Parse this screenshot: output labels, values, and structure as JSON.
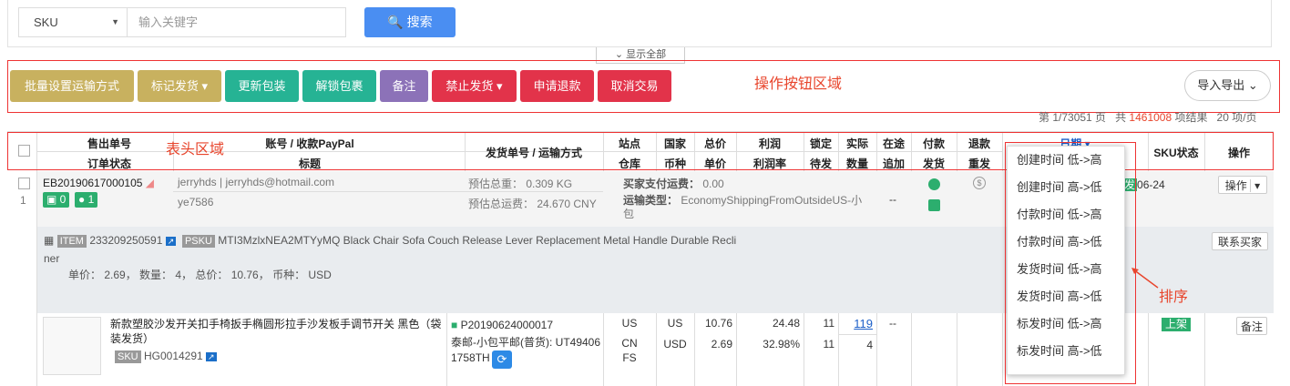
{
  "search": {
    "field": "SKU",
    "placeholder": "输入关键字",
    "button": "搜索",
    "show_all": "显示全部"
  },
  "actions": [
    {
      "label": "批量设置运输方式",
      "color": "#c8b15f"
    },
    {
      "label": "标记发货",
      "color": "#c8b15f"
    },
    {
      "label": "更新包装",
      "color": "#26b394"
    },
    {
      "label": "解锁包裹",
      "color": "#26b394"
    },
    {
      "label": "备注",
      "color": "#8c72b8"
    },
    {
      "label": "禁止发货",
      "color": "#e2334a"
    },
    {
      "label": "申请退款",
      "color": "#e2334a"
    },
    {
      "label": "取消交易",
      "color": "#e2334a"
    }
  ],
  "annotations": {
    "buttons_area": "操作按钮区域",
    "header_area": "表头区域",
    "sort": "排序"
  },
  "import_export": "导入导出",
  "pager": {
    "prefix": "第 1/73051 页",
    "total_prefix": "共",
    "total": "1461008",
    "total_suffix": "项结果",
    "per_page": "20 项/页"
  },
  "headers": {
    "order_no": "售出单号",
    "order_status": "订单状态",
    "account": "账号 / 收款PayPal",
    "title": "标题",
    "ship_no": "发货单号 / 运输方式",
    "site": "站点",
    "warehouse": "仓库",
    "country": "国家",
    "currency": "币种",
    "total": "总价",
    "unit": "单价",
    "profit": "利润",
    "profit_rate": "利润率",
    "locked": "锁定",
    "pending": "待发",
    "actual": "实际",
    "qty": "数量",
    "transit": "在途",
    "append": "追加",
    "pay": "付款",
    "ship": "发货",
    "refund": "退款",
    "reship": "重发",
    "date": "日期",
    "sku_status": "SKU状态",
    "ops": "操作"
  },
  "sort_options": [
    "创建时间 低->高",
    "创建时间 高->低",
    "付款时间 低->高",
    "付款时间 高->低",
    "发货时间 低->高",
    "发货时间 高->低",
    "标发时间 低->高",
    "标发时间 高->低"
  ],
  "order": {
    "index": "1",
    "order_no": "EB20190617000105",
    "badge_box": "0",
    "badge_user": "1",
    "account": "jerryhds | jerryhds@hotmail.com",
    "buyer": "ye7586",
    "est_weight": "预估总重： 0.309 KG",
    "est_freight": "预估总运费： 24.670 CNY",
    "buyer_paid_label": "买家支付运费：",
    "buyer_paid": "0.00",
    "ship_type_label": "运输类型：",
    "ship_type": "EconomyShippingFromOutsideUS-小包",
    "transit": "--",
    "date": "06-24",
    "ops": "操作"
  },
  "item": {
    "item_tag": "ITEM",
    "item_id": "233209250591",
    "psku_tag": "PSKU",
    "psku": "MTI3MzlxNEA2MTYyMQ",
    "title1": "Black Chair Sofa Couch Release Lever Replacement Metal Handle Durable Recli",
    "title2": "ner",
    "summary": "单价： 2.69， 数量： 4， 总价： 10.76， 币种： USD",
    "contact": "联系买家"
  },
  "product": {
    "name": "新款塑胶沙发开关扣手椅扳手椭圆形拉手沙发板手调节开关 黑色（袋装发货）",
    "sku_tag": "SKU",
    "sku": "HG0014291",
    "ship_no": "P20190624000017",
    "ship_method": "泰邮-小包平邮(普货): UT49406 1758TH",
    "site": "US",
    "warehouse1": "CN",
    "warehouse2": "FS",
    "country": "US",
    "currency": "USD",
    "total": "10.76",
    "unit": "2.69",
    "profit": "24.48",
    "profit_rate": "32.98%",
    "locked": "11",
    "pending": "11",
    "actual": "119",
    "qty": "4",
    "transit": "--",
    "sku_status": "上架",
    "note": "备注"
  }
}
